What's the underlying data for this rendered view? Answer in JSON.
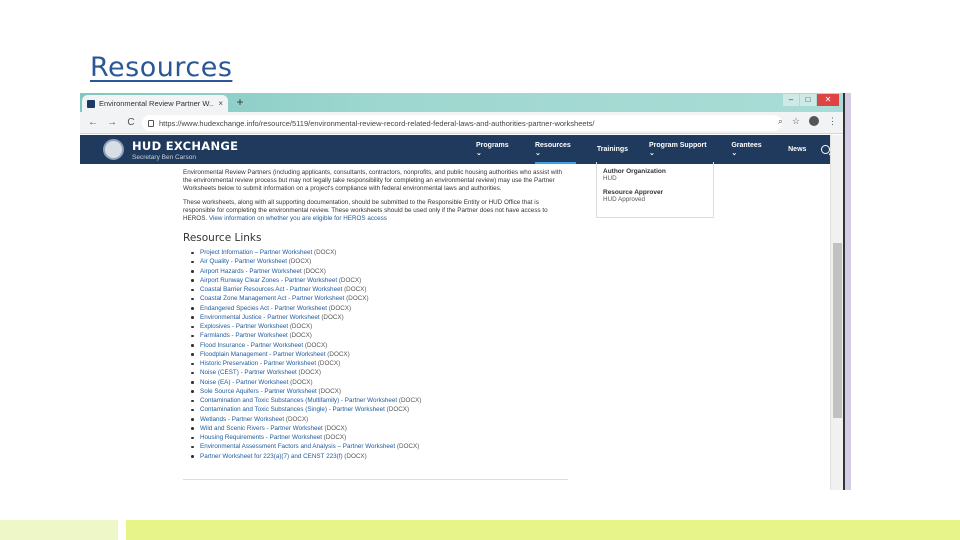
{
  "slide": {
    "title": "Resources"
  },
  "browser": {
    "tab_title": "Environmental Review Partner W...",
    "tab_close": "×",
    "new_tab": "+",
    "win_minimize": "–",
    "win_maximize": "□",
    "win_close": "✕",
    "back": "←",
    "forward": "→",
    "reload": "C",
    "url": "https://www.hudexchange.info/resource/5119/environmental-review-record-related-federal-laws-and-authorities-partner-worksheets/",
    "zoom_icon": "⌕",
    "star_icon": "☆",
    "menu_icon": "⋮"
  },
  "header": {
    "brand": "HUD EXCHANGE",
    "subtitle": "Secretary Ben Carson",
    "nav": [
      {
        "label": "Programs ⌄"
      },
      {
        "label": "Resources ⌄"
      },
      {
        "label": "Trainings"
      },
      {
        "label": "Program Support ⌄"
      },
      {
        "label": "Grantees ⌄"
      },
      {
        "label": "News"
      }
    ]
  },
  "sidebar": {
    "author_label": "Author Organization",
    "author_value": "HUD",
    "approver_label": "Resource Approver",
    "approver_value": "HUD Approved"
  },
  "content": {
    "para1": "Environmental Review Partners (including applicants, consultants, contractors, nonprofits, and public housing authorities who assist with the environmental review process but may not legally take responsibility for completing an environmental review) may use the Partner Worksheets below to submit information on a project's compliance with federal environmental laws and authorities.",
    "para2_text": "These worksheets, along with all supporting documentation, should be submitted to the Responsible Entity or HUD Office that is responsible for completing the environmental review. These worksheets should be used only if the Partner does not have access to HEROS.",
    "para2_link": "View information on whether you are eligible for HEROS access",
    "heading": "Resource Links",
    "links": [
      {
        "text": "Project Information – Partner Worksheet",
        "suffix": " (DOCX)"
      },
      {
        "text": "Air Quality - Partner Worksheet",
        "suffix": " (DOCX)"
      },
      {
        "text": "Airport Hazards - Partner Worksheet",
        "suffix": " (DOCX)"
      },
      {
        "text": "Airport Runway Clear Zones - Partner Worksheet",
        "suffix": " (DOCX)"
      },
      {
        "text": "Coastal Barrier Resources Act - Partner Worksheet",
        "suffix": " (DOCX)"
      },
      {
        "text": "Coastal Zone Management Act - Partner Worksheet",
        "suffix": " (DOCX)"
      },
      {
        "text": "Endangered Species Act - Partner Worksheet",
        "suffix": " (DOCX)"
      },
      {
        "text": "Environmental Justice - Partner Worksheet",
        "suffix": " (DOCX)"
      },
      {
        "text": "Explosives - Partner Worksheet",
        "suffix": " (DOCX)"
      },
      {
        "text": "Farmlands - Partner Worksheet",
        "suffix": " (DOCX)"
      },
      {
        "text": "Flood Insurance - Partner Worksheet",
        "suffix": " (DOCX)"
      },
      {
        "text": "Floodplain Management - Partner Worksheet",
        "suffix": " (DOCX)"
      },
      {
        "text": "Historic Preservation - Partner Worksheet",
        "suffix": " (DOCX)"
      },
      {
        "text": "Noise (CEST) - Partner Worksheet",
        "suffix": " (DOCX)"
      },
      {
        "text": "Noise (EA) - Partner Worksheet",
        "suffix": " (DOCX)"
      },
      {
        "text": "Sole Source Aquifers - Partner Worksheet",
        "suffix": " (DOCX)"
      },
      {
        "text": "Contamination and Toxic Substances (Multifamily) - Partner Worksheet",
        "suffix": " (DOCX)"
      },
      {
        "text": "Contamination and Toxic Substances (Single) - Partner Worksheet",
        "suffix": " (DOCX)"
      },
      {
        "text": "Wetlands - Partner Worksheet",
        "suffix": " (DOCX)"
      },
      {
        "text": "Wild and Scenic Rivers - Partner Worksheet",
        "suffix": " (DOCX)"
      },
      {
        "text": "Housing Requirements - Partner Worksheet",
        "suffix": " (DOCX)"
      },
      {
        "text": "Environmental Assessment Factors and Analysis – Partner Worksheet",
        "suffix": " (DOCX)"
      },
      {
        "text": "Partner Worksheet for 223(a)(7) and CENST 223(f)",
        "suffix": " (DOCX)"
      }
    ]
  }
}
